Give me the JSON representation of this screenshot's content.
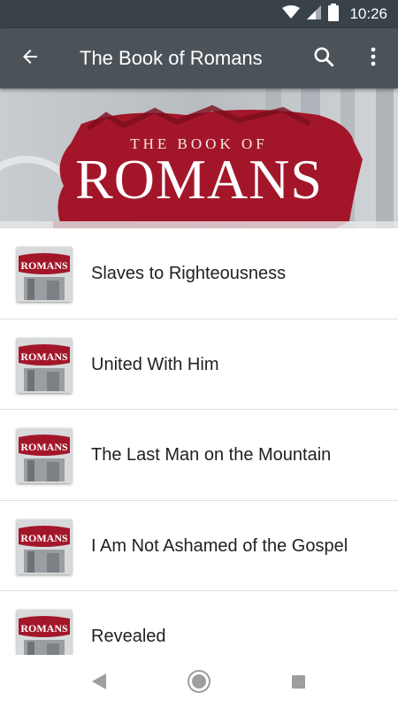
{
  "status_bar": {
    "time": "10:26",
    "icons": [
      "wifi-icon",
      "cell-signal-icon",
      "battery-icon"
    ]
  },
  "app_bar": {
    "title": "The Book of Romans",
    "back_icon": "arrow-back-icon",
    "search_icon": "search-icon",
    "more_icon": "more-vert-icon"
  },
  "banner": {
    "subtitle": "THE BOOK OF",
    "title": "ROMANS"
  },
  "sermons": [
    {
      "title": "Slaves to Righteousness",
      "thumb_text": "ROMANS"
    },
    {
      "title": "United With Him",
      "thumb_text": "ROMANS"
    },
    {
      "title": "The Last Man on the Mountain",
      "thumb_text": "ROMANS"
    },
    {
      "title": "I Am Not Ashamed of the Gospel",
      "thumb_text": "ROMANS"
    },
    {
      "title": "Revealed",
      "thumb_text": "ROMANS"
    }
  ],
  "nav_bar": {
    "icons": [
      "nav-back-icon",
      "nav-home-icon",
      "nav-recents-icon"
    ]
  },
  "colors": {
    "status_bar": "#3a4249",
    "app_bar": "#4b5359",
    "brush_red": "#a3162a"
  }
}
